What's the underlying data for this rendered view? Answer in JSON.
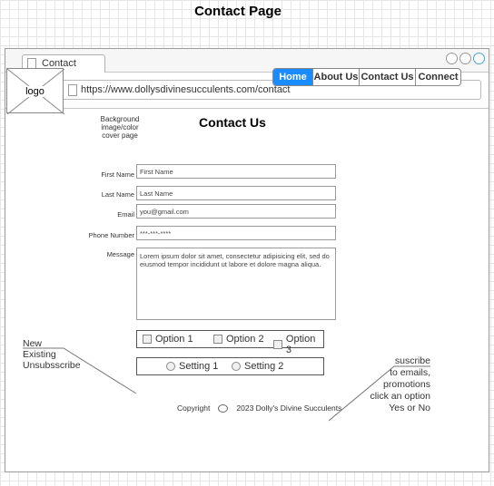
{
  "page_heading": "Contact Page",
  "browser": {
    "tab_label": "Contact",
    "url": "https://www.dollysdivinesucculents.com/contact"
  },
  "site": {
    "logo_label": "logo",
    "menu": [
      {
        "label": "Home",
        "active": true
      },
      {
        "label": "About Us",
        "active": false
      },
      {
        "label": "Contact Us",
        "active": false
      },
      {
        "label": "Connect",
        "active": false
      }
    ],
    "background_note": "Background image/color cover page",
    "title": "Contact Us"
  },
  "form": {
    "first_name": {
      "label": "First Name",
      "placeholder": "First Name"
    },
    "last_name": {
      "label": "Last Name",
      "placeholder": "Last Name"
    },
    "email": {
      "label": "Email",
      "placeholder": "you@gmail.com"
    },
    "phone": {
      "label": "Phone Number",
      "placeholder": "***-***-****"
    },
    "message": {
      "label": "Message",
      "value": "Lorem ipsum dolor sit amet, consectetur adipisicing elit, sed do eiusmod tempor incididunt ut labore et dolore magna aliqua."
    },
    "options": [
      "Option 1",
      "Option 2",
      "Option 3"
    ],
    "settings": [
      "Setting 1",
      "Setting 2"
    ]
  },
  "footer": {
    "copyright_label": "Copyright",
    "copyright_text": "2023 Dolly's Divine Succulents"
  },
  "annotations": {
    "left": [
      "New",
      "Existing",
      "Unsubsscribe"
    ],
    "right": [
      "suscribe",
      "to emails,",
      "promotions",
      "click an option",
      "Yes or No"
    ]
  },
  "colors": {
    "menu_active": "#1a8cff",
    "window_active_button": "#4aa3df"
  }
}
